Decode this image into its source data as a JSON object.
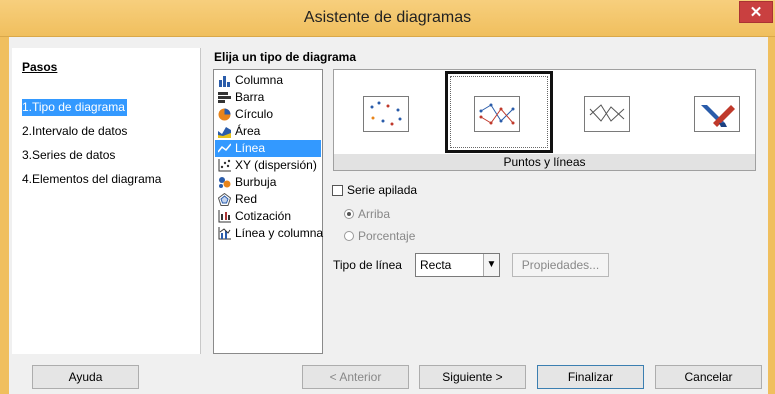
{
  "window": {
    "title": "Asistente de diagramas",
    "close_glyph": "✕"
  },
  "steps": {
    "heading": "Pasos",
    "items": [
      "1.Tipo de diagrama",
      "2.Intervalo de datos",
      "3.Series de datos",
      "4.Elementos del diagrama"
    ],
    "active_index": 0
  },
  "chart_type": {
    "heading": "Elija un tipo de diagrama",
    "types": [
      {
        "label": "Columna",
        "icon": "column-chart-icon"
      },
      {
        "label": "Barra",
        "icon": "bar-chart-icon"
      },
      {
        "label": "Círculo",
        "icon": "pie-chart-icon"
      },
      {
        "label": "Área",
        "icon": "area-chart-icon"
      },
      {
        "label": "Línea",
        "icon": "line-chart-icon"
      },
      {
        "label": "XY (dispersión)",
        "icon": "scatter-chart-icon"
      },
      {
        "label": "Burbuja",
        "icon": "bubble-chart-icon"
      },
      {
        "label": "Red",
        "icon": "net-chart-icon"
      },
      {
        "label": "Cotización",
        "icon": "stock-chart-icon"
      },
      {
        "label": "Línea y columna",
        "icon": "line-column-chart-icon"
      }
    ],
    "selected": "Línea"
  },
  "variants": {
    "selected_caption": "Puntos y líneas",
    "items": [
      "points-only-icon",
      "points-and-lines-icon",
      "lines-only-icon",
      "3d-lines-icon"
    ]
  },
  "options": {
    "stacked_label": "Serie apilada",
    "stacked_checked": false,
    "radio_top_label": "Arriba",
    "radio_percent_label": "Porcentaje",
    "line_type_label": "Tipo de línea",
    "line_type_value": "Recta",
    "properties_label": "Propiedades..."
  },
  "buttons": {
    "help": "Ayuda",
    "previous": "< Anterior",
    "next": "Siguiente >",
    "finish": "Finalizar",
    "cancel": "Cancelar"
  },
  "colors": {
    "title_bar": "#f0bf5e",
    "selection": "#3399ff",
    "close_button": "#c94040"
  }
}
